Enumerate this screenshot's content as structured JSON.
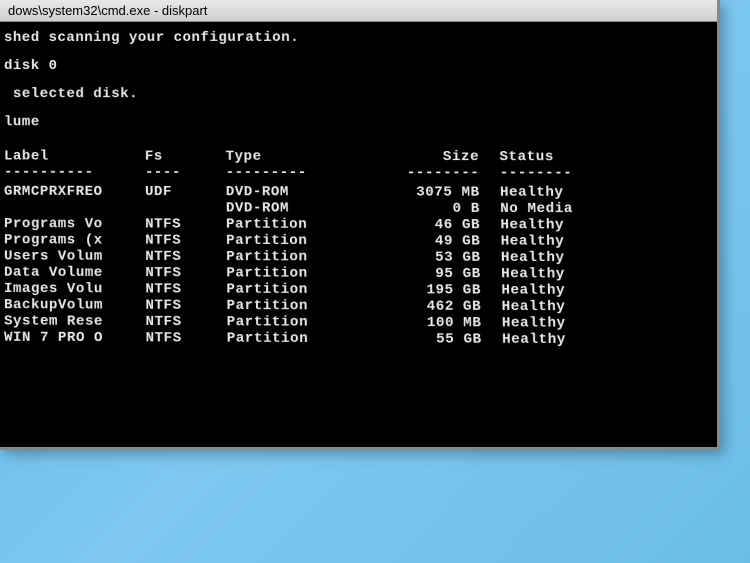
{
  "window": {
    "title": "dows\\system32\\cmd.exe - diskpart"
  },
  "output": {
    "line1": "shed scanning your configuration.",
    "line2": "disk 0",
    "line3": " selected disk.",
    "line4": "lume"
  },
  "columns": {
    "label": "Label",
    "fs": "Fs",
    "type": "Type",
    "size": "Size",
    "status": "Status"
  },
  "underlines": {
    "label": "----------",
    "fs": "----",
    "type": "---------",
    "size": "--------",
    "status": "--------"
  },
  "volumes": [
    {
      "label": "GRMCPRXFREO",
      "fs": "UDF",
      "type": "DVD-ROM",
      "size": "3075 MB",
      "status": "Healthy"
    },
    {
      "label": "",
      "fs": "",
      "type": "DVD-ROM",
      "size": "0 B",
      "status": "No Media"
    },
    {
      "label": "Programs Vo",
      "fs": "NTFS",
      "type": "Partition",
      "size": "46 GB",
      "status": "Healthy"
    },
    {
      "label": "Programs (x",
      "fs": "NTFS",
      "type": "Partition",
      "size": "49 GB",
      "status": "Healthy"
    },
    {
      "label": "Users Volum",
      "fs": "NTFS",
      "type": "Partition",
      "size": "53 GB",
      "status": "Healthy"
    },
    {
      "label": "Data Volume",
      "fs": "NTFS",
      "type": "Partition",
      "size": "95 GB",
      "status": "Healthy"
    },
    {
      "label": "Images Volu",
      "fs": "NTFS",
      "type": "Partition",
      "size": "195 GB",
      "status": "Healthy"
    },
    {
      "label": "BackupVolum",
      "fs": "NTFS",
      "type": "Partition",
      "size": "462 GB",
      "status": "Healthy"
    },
    {
      "label": "System Rese",
      "fs": "NTFS",
      "type": "Partition",
      "size": "100 MB",
      "status": "Healthy"
    },
    {
      "label": "WIN 7 PRO O",
      "fs": "NTFS",
      "type": "Partition",
      "size": "55 GB",
      "status": "Healthy"
    }
  ]
}
